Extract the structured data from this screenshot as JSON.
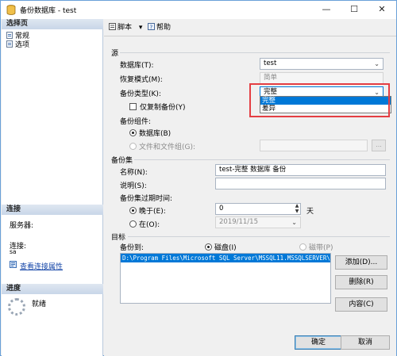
{
  "window": {
    "title": "备份数据库 - test",
    "controls": {
      "minimize": "—",
      "maximize": "☐",
      "close": "✕"
    }
  },
  "left": {
    "select_page_header": "选择页",
    "pages": [
      {
        "label": "常规"
      },
      {
        "label": "选项"
      }
    ],
    "connection_header": "连接",
    "server_label": "服务器:",
    "connection_label": "连接:",
    "connection_user": "sa",
    "view_connection_props": "查看连接属性",
    "progress_header": "进度",
    "progress_status": "就绪"
  },
  "toolbar": {
    "script_label": "脚本",
    "script_arrow": "▾",
    "help_label": "帮助"
  },
  "source": {
    "section": "源",
    "database_label": "数据库(T):",
    "database_value": "test",
    "recovery_label": "恢复模式(M):",
    "recovery_value": "简单",
    "backup_type_label": "备份类型(K):",
    "backup_type_value": "完整",
    "backup_type_options": [
      "完整",
      "差异"
    ],
    "copy_only_label": "仅复制备份(Y)",
    "component_label": "备份组件:",
    "component_database": "数据库(B)",
    "component_files": "文件和文件组(G):",
    "browse_label": "..."
  },
  "backup_set": {
    "section": "备份集",
    "name_label": "名称(N):",
    "name_value": "test-完整 数据库 备份",
    "desc_label": "说明(S):",
    "desc_value": "",
    "expire_label": "备份集过期时间:",
    "after_label": "晚于(E):",
    "after_value": "0",
    "days_label": "天",
    "on_label": "在(O):",
    "on_value": "2019/11/15"
  },
  "destination": {
    "section": "目标",
    "backup_to_label": "备份到:",
    "disk_label": "磁盘(I)",
    "tape_label": "磁带(P)",
    "paths": [
      "D:\\Program Files\\Microsoft SQL Server\\MSSQL11.MSSQLSERVER\\MSSQ"
    ],
    "add_button": "添加(D)...",
    "remove_button": "删除(R)",
    "contents_button": "内容(C)"
  },
  "footer": {
    "ok_button": "确定",
    "cancel_button": "取消"
  },
  "colors": {
    "selection": "#0078d7",
    "highlight_box": "#e43e43",
    "link": "#1546a8"
  }
}
